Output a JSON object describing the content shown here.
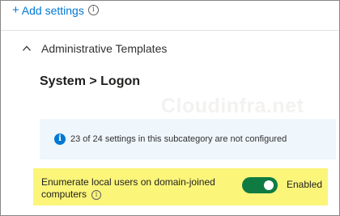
{
  "toolbar": {
    "add_settings_label": "Add settings",
    "add_settings_icon": "plus-icon",
    "info_icon": "info-icon"
  },
  "section": {
    "title": "Administrative Templates",
    "expanded": true,
    "chevron_icon": "chevron-up-icon"
  },
  "page": {
    "title": "System > Logon"
  },
  "watermark": {
    "text": "Cloudinfra.net"
  },
  "info_banner": {
    "icon": "info-filled-icon",
    "message": "23 of 24 settings in this subcategory are not configured"
  },
  "setting": {
    "label": "Enumerate local users on domain-joined computers",
    "info_icon": "info-icon",
    "toggle_state": "on",
    "toggle_label": "Enabled",
    "highlight_color": "#fbf57a",
    "toggle_color": "#0f7b43"
  },
  "colors": {
    "accent": "#0078d4",
    "banner_bg": "#eff6fc"
  }
}
